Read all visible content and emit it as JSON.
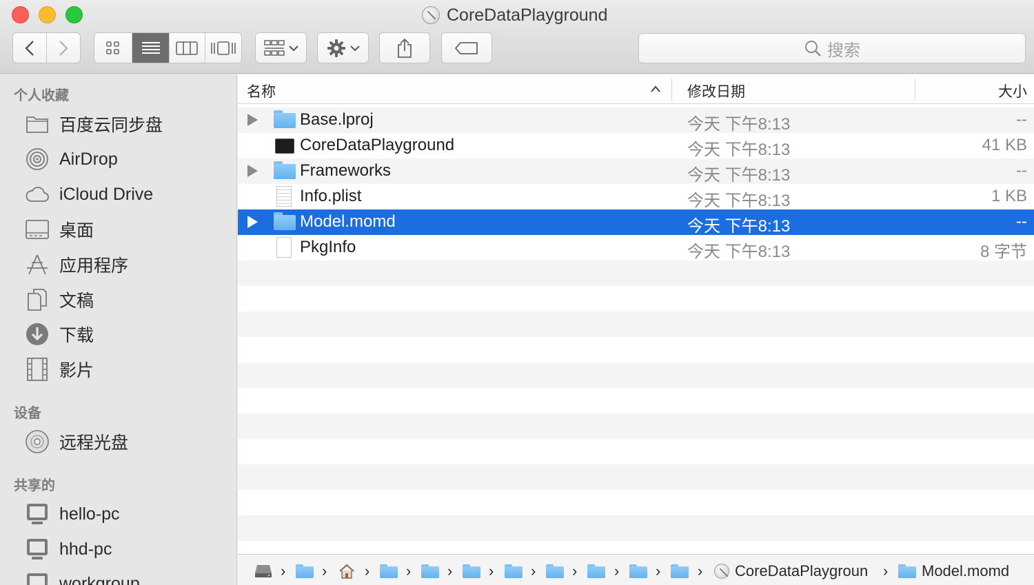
{
  "window": {
    "title": "CoreDataPlayground"
  },
  "toolbar": {
    "back_icon": "chevron-left-icon",
    "forward_icon": "chevron-right-icon",
    "view_modes": [
      "icon-view-icon",
      "list-view-icon",
      "column-view-icon",
      "coverflow-view-icon"
    ],
    "active_view": "list",
    "search_placeholder": "搜索"
  },
  "sidebar": {
    "sections": [
      {
        "title": "个人收藏",
        "items": [
          {
            "label": "百度云同步盘",
            "icon": "folder-icon"
          },
          {
            "label": "AirDrop",
            "icon": "airdrop-icon"
          },
          {
            "label": "iCloud Drive",
            "icon": "cloud-icon"
          },
          {
            "label": "桌面",
            "icon": "desktop-icon"
          },
          {
            "label": "应用程序",
            "icon": "applications-icon"
          },
          {
            "label": "文稿",
            "icon": "documents-icon"
          },
          {
            "label": "下载",
            "icon": "download-icon"
          },
          {
            "label": "影片",
            "icon": "movies-icon"
          }
        ]
      },
      {
        "title": "设备",
        "items": [
          {
            "label": "远程光盘",
            "icon": "disc-icon"
          }
        ]
      },
      {
        "title": "共享的",
        "items": [
          {
            "label": "hello-pc",
            "icon": "computer-icon"
          },
          {
            "label": "hhd-pc",
            "icon": "computer-icon"
          },
          {
            "label": "workgroup",
            "icon": "computer-icon"
          }
        ]
      }
    ]
  },
  "list": {
    "columns": {
      "name": "名称",
      "date": "修改日期",
      "size": "大小"
    },
    "rows": [
      {
        "name": "Base.lproj",
        "date": "今天 下午8:13",
        "size": "--",
        "kind": "folder",
        "expandable": true
      },
      {
        "name": "CoreDataPlayground",
        "date": "今天 下午8:13",
        "size": "41 KB",
        "kind": "executable",
        "expandable": false
      },
      {
        "name": "Frameworks",
        "date": "今天 下午8:13",
        "size": "--",
        "kind": "folder",
        "expandable": true
      },
      {
        "name": "Info.plist",
        "date": "今天 下午8:13",
        "size": "1 KB",
        "kind": "plist",
        "expandable": false
      },
      {
        "name": "Model.momd",
        "date": "今天 下午8:13",
        "size": "--",
        "kind": "folder",
        "expandable": true,
        "selected": true
      },
      {
        "name": "PkgInfo",
        "date": "今天 下午8:13",
        "size": "8 字节",
        "kind": "document",
        "expandable": false
      }
    ],
    "selection_color": "#1c6ee0"
  },
  "pathbar": {
    "app_label": "CoreDataPlaygroun",
    "current_label": "Model.momd"
  }
}
